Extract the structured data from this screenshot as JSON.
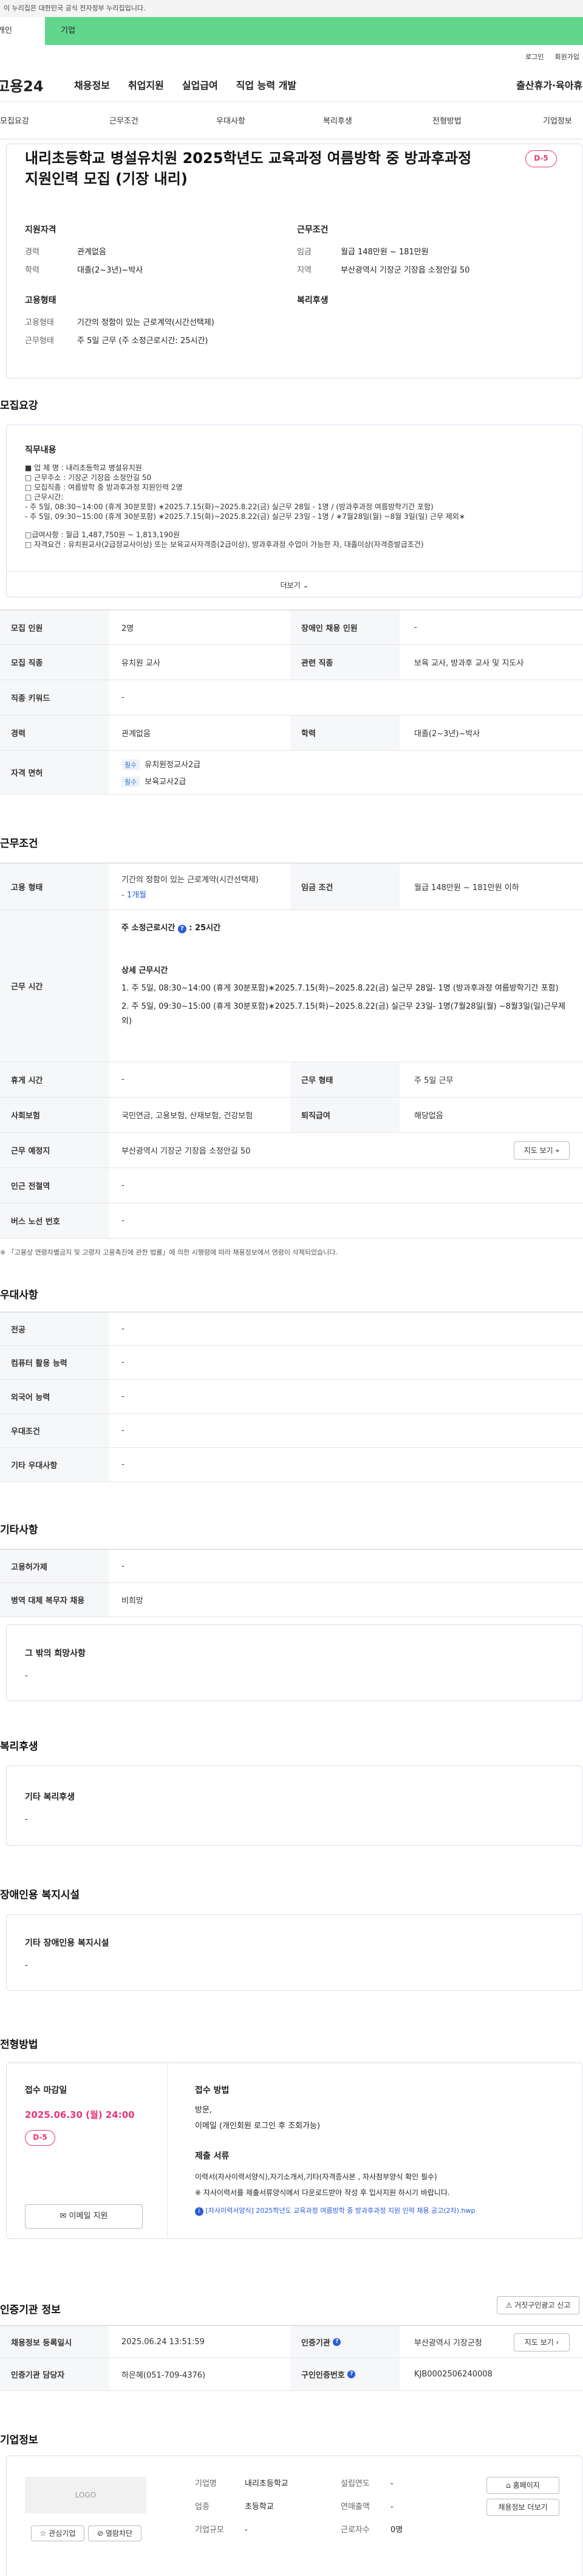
{
  "gov_banner": "이 누리집은 대한민국 공식 전자정부 누리집입니다.",
  "top_tabs": [
    "개인",
    "기업"
  ],
  "util": {
    "login": "로그인",
    "join": "회원가입"
  },
  "gnb": {
    "logo": "고용24",
    "items": [
      "채용정보",
      "취업지원",
      "실업급여",
      "직업 능력 개발",
      "출산휴가·육아휴직"
    ]
  },
  "snb": [
    "모집요강",
    "근무조건",
    "우대사항",
    "복리후생",
    "전형방법",
    "기업정보"
  ],
  "header": {
    "title": "내리초등학교 병설유치원 2025학년도 교육과정 여름방학 중 방과후과정 지원인력 모집 (기장 내리)",
    "dday": "D-5",
    "qual_title": "지원자격",
    "career_k": "경력",
    "career_v": "관계없음",
    "edu_k": "학력",
    "edu_v": "대졸(2~3년)~박사",
    "cond_title": "근무조건",
    "wage_k": "임금",
    "wage_v": "월급 148만원 ~ 181만원",
    "region_k": "지역",
    "region_v": "부산광역시 기장군 기장읍 소정안길 50",
    "emp_title": "고용형태",
    "emp_type_k": "고용형태",
    "emp_type_v": "기간의 정함이 있는 근로계약(시간선택제)",
    "hours_k": "근무형태",
    "hours_v": "주 5일 근무 (주 소정근로시간: 25시간)",
    "welfare_title": "복리후생"
  },
  "recruit": {
    "title": "모집요강",
    "duty_title": "직무내용",
    "duty_lines": [
      "■ 업 제 명 : 내리초등학교 병설유치원",
      "□ 근무주소 : 기장군 기장읍 소정안길 50",
      "□ 모집직종 : 여름방학 중 방과후과정 지원인력 2명",
      "□ 근무시간:",
      "- 주 5일, 08:30~14:00 (휴게 30분포함) ∗2025.7.15(화)~2025.8.22(금) 실근무 28일 - 1명 / (방과후과정 여름방학기간 포함)",
      "- 주 5일, 09:30~15:00 (휴게 30분포함) ∗2025.7.15(화)~2025.8.22(금) 실근무 23일 - 1명 / ∗7월28일(월) ~8월 3일(일) 근무 제외∗",
      "□급여사항 : 월급 1,487,750원 ~ 1,813,190원",
      "□ 자격요건 : 유치원교사(2급정교사이상) 또는 보육교사자격증(2급이상), 방과후과정 수업이 가능한 자, 대졸이상(자격증발급조건)"
    ],
    "more": "더보기",
    "rows": [
      {
        "k1": "모집 인원",
        "v1": "2명",
        "k2": "장애인 채용 인원",
        "v2": "-"
      },
      {
        "k1": "모집 직종",
        "v1": "유치원 교사",
        "k2": "관련 직종",
        "v2": "보육 교사, 방과후 교사 및 지도사"
      },
      {
        "k1": "직종 키워드",
        "v1": "-"
      },
      {
        "k1": "경력",
        "v1": "관계없음",
        "k2": "학력",
        "v2": "대졸(2~3년)~박사"
      }
    ],
    "license_k": "자격 면허",
    "license_tag": "필수",
    "licenses": [
      "유치원정교사2급",
      "보육교사2급"
    ]
  },
  "work": {
    "title": "근무조건",
    "emp_k": "고용 형태",
    "emp_v": "기간의 정함이 있는 근로계약(시간선택제)",
    "emp_period": "- 1개월",
    "wage_k": "임금 조건",
    "wage_v": "월급 148만원 ~ 181만원 이하",
    "time_k": "근무 시간",
    "weekly": "주 소정근로시간",
    "weekly_v": "25시간",
    "detail_title": "상세 근무시간",
    "detail_lines": [
      "1. 주 5일, 08:30~14:00 (휴게 30분포함)∗2025.7.15(화)~2025.8.22(금) 실근무 28일- 1명 (방과후과정 여름방학기간 포함)",
      "2. 주 5일, 09:30~15:00 (휴게 30분포함)∗2025.7.15(화)~2025.8.22(금) 실근무 23일- 1명(7월28일(월) ~8월3일(일)근무제외)"
    ],
    "break_k": "휴게 시간",
    "break_v": "-",
    "form_k": "근무 형태",
    "form_v": "주 5일 근무",
    "ins_k": "사회보험",
    "ins_v": "국민연금, 고용보험, 산재보험, 건강보험",
    "sev_k": "퇴직급여",
    "sev_v": "해당없음",
    "place_k": "근무 예정지",
    "place_v": "부산광역시 기장군 기장읍 소정안길 50",
    "map_btn": "지도 보기",
    "subway_k": "인근 전철역",
    "subway_v": "-",
    "bus_k": "버스 노선 번호",
    "bus_v": "-",
    "note": "※ 「고용상 연령차별금지 및 고령자 고용촉진에 관한 법률」에 의한 시행령에 따라 채용정보에서 연령이 삭제되었습니다."
  },
  "prefer": {
    "title": "우대사항",
    "rows": [
      {
        "k": "전공",
        "v": "-"
      },
      {
        "k": "컴퓨터 활용 능력",
        "v": "-"
      },
      {
        "k": "외국어 능력",
        "v": "-"
      },
      {
        "k": "우대조건",
        "v": "-"
      },
      {
        "k": "기타 우대사항",
        "v": "-"
      }
    ]
  },
  "etc": {
    "title": "기타사항",
    "rows": [
      {
        "k": "고용허가제",
        "v": "-"
      },
      {
        "k": "병역 대체 복무자 채용",
        "v": "비희망"
      }
    ],
    "other_title": "그 밖의 희망사항",
    "other_v": "-"
  },
  "welfare": {
    "title": "복리후생",
    "box_title": "기타 복리후생",
    "box_v": "-"
  },
  "disab": {
    "title": "장애인용 복지시설",
    "box_title": "기타 장애인용 복지시설",
    "box_v": "-"
  },
  "process": {
    "title": "전형방법",
    "deadline_t": "접수 마감일",
    "deadline_v": "2025.06.30 (월) 24:00",
    "dday": "D-5",
    "email_btn": "이메일 지원",
    "method_t": "접수 방법",
    "method_v1": "방문,",
    "method_v2": "이메일 (개인회원 로그인 후 조회가능)",
    "docs_t": "제출 서류",
    "docs_v1": "이력서(자사이력서양식),자기소개서,기타(자격증사본 , 자사첨부양식 확인 필수)",
    "docs_v2": "※ 자사이력서를 제출서류양식에서 다운로드받아 작성 후 입사지원 하시기 바랍니다.",
    "docs_file": "[자사이력서양식] 2025학년도 교육과정 여름방학 중 방과후과정 지원 인력 채용 공고(2차).hwp"
  },
  "agency": {
    "title": "인증기관 정보",
    "report_btn": "거짓구인광고 신고",
    "reg_k": "채용정보 등록일시",
    "reg_v": "2025.06.24 13:51:59",
    "org_k": "인증기관",
    "org_v": "부산광역시 기장군청",
    "map_btn": "지도 보기",
    "mgr_k": "인증기관 담당자",
    "mgr_v": "하은혜(051-709-4376)",
    "no_k": "구인인증번호",
    "no_v": "KJB0002506240008"
  },
  "company": {
    "title": "기업정보",
    "logo": "LOGO",
    "fav_btn": "관심기업",
    "block_btn": "열람차단",
    "name_k": "기업명",
    "name_v": "내리초등학교",
    "est_k": "설립연도",
    "est_v": "-",
    "ind_k": "업종",
    "ind_v": "초등학교",
    "sales_k": "연매출액",
    "sales_v": "-",
    "size_k": "기업규모",
    "size_v": "-",
    "emp_k": "근로자수",
    "emp_v": "0명",
    "home_btn": "홈페이지",
    "info_btn": "채용정보 더보기"
  }
}
